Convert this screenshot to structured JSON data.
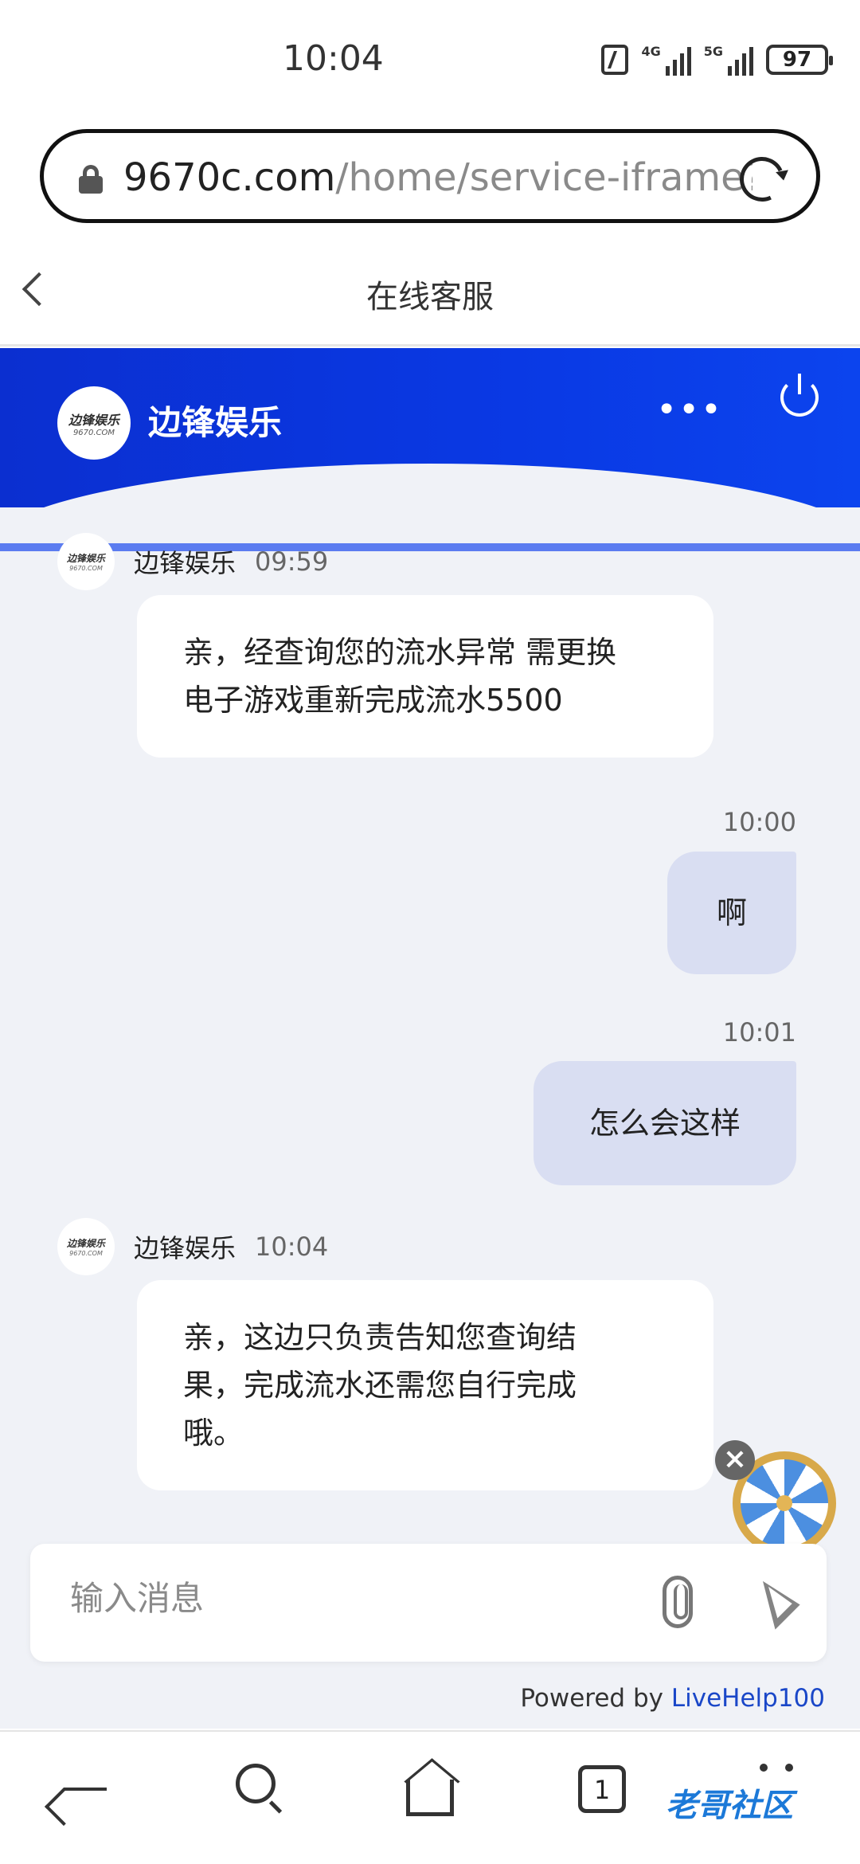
{
  "status_bar": {
    "time": "10:04",
    "net1": "4G",
    "net2": "5G",
    "battery": "97"
  },
  "browser": {
    "url_domain": "9670c.com",
    "url_path": "/home/service-iframe?u"
  },
  "page": {
    "title": "在线客服"
  },
  "chat_header": {
    "brand_name": "边锋娱乐",
    "logo_line1": "边锋娱乐",
    "logo_line2": "9670.COM",
    "more": "•••"
  },
  "messages": [
    {
      "from": "agent",
      "sender": "边锋娱乐",
      "time": "09:59",
      "lines": [
        "亲，经查询您的流水异常 需更换",
        "电子游戏重新完成流水5500"
      ]
    },
    {
      "from": "user",
      "time": "10:00",
      "text": "啊"
    },
    {
      "from": "user",
      "time": "10:01",
      "text": "怎么会这样"
    },
    {
      "from": "agent",
      "sender": "边锋娱乐",
      "time": "10:04",
      "lines": [
        "亲，这边只负责告知您查询结",
        "果，完成流水还需您自行完成",
        "哦。"
      ]
    }
  ],
  "composer": {
    "placeholder": "输入消息"
  },
  "footer": {
    "powered_prefix": "Powered by ",
    "powered_brand": "LiveHelp100"
  },
  "widget": {
    "close": "×"
  },
  "bottom_nav": {
    "tab_count": "1",
    "watermark": "老哥社区"
  },
  "colors": {
    "header_blue": "#0b33de",
    "user_bubble": "#d9def2",
    "chat_bg": "#f0f2f7",
    "link_blue": "#1a47c8"
  }
}
